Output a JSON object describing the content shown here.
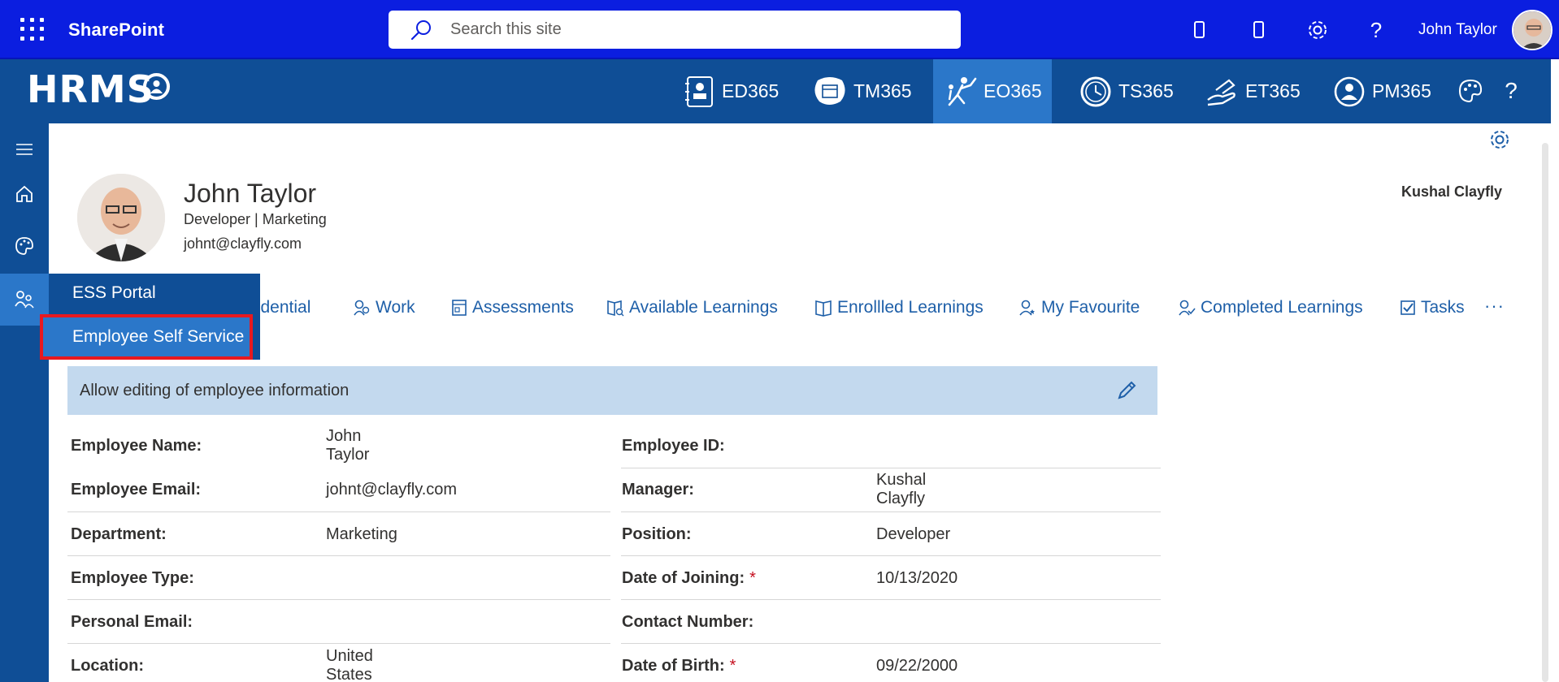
{
  "suitebar": {
    "brand": "SharePoint",
    "search_placeholder": "Search this site",
    "user_name": "John Taylor"
  },
  "hrms": {
    "logo": "HRMS",
    "apps": [
      {
        "label": "ED365",
        "icon": "employee-directory-icon"
      },
      {
        "label": "TM365",
        "icon": "calendar-bubble-icon"
      },
      {
        "label": "EO365",
        "icon": "onboarding-climber-icon"
      },
      {
        "label": "TS365",
        "icon": "clock-icon"
      },
      {
        "label": "ET365",
        "icon": "expense-hand-icon"
      },
      {
        "label": "PM365",
        "icon": "performance-person-icon"
      }
    ],
    "active_app": "EO365"
  },
  "rail": {
    "items": [
      "menu-icon",
      "home-icon",
      "palette-icon",
      "people-icon"
    ]
  },
  "flyout": {
    "header": "ESS Portal",
    "item": "Employee Self Service"
  },
  "profile": {
    "name": "John Taylor",
    "subtitle": "Developer | Marketing",
    "email": "johnt@clayfly.com",
    "manager": "Kushal Clayfly"
  },
  "tabs": {
    "partial": "fidential",
    "items": [
      "Work",
      "Assessments",
      "Available Learnings",
      "Enrollled Learnings",
      "My Favourite",
      "Completed Learnings",
      "Tasks"
    ],
    "more": "···"
  },
  "banner": {
    "text": "Allow editing of employee information"
  },
  "fields_left": [
    {
      "label": "Employee Name:",
      "value": "John Taylor"
    },
    {
      "label": "Employee Email:",
      "value": "johnt@clayfly.com"
    },
    {
      "label": "Department:",
      "value": "Marketing"
    },
    {
      "label": "Employee Type:",
      "value": ""
    },
    {
      "label": "Personal Email:",
      "value": ""
    },
    {
      "label": "Location:",
      "value": "United States"
    }
  ],
  "fields_right": [
    {
      "label": "Employee ID:",
      "value": "",
      "required": ""
    },
    {
      "label": "Manager:",
      "value": "Kushal Clayfly",
      "required": ""
    },
    {
      "label": "Position:",
      "value": "Developer",
      "required": ""
    },
    {
      "label": "Date of Joining:",
      "value": "10/13/2020",
      "required": "*"
    },
    {
      "label": "Contact Number:",
      "value": "",
      "required": ""
    },
    {
      "label": "Date of Birth:",
      "value": "09/22/2000",
      "required": "*"
    }
  ],
  "colors": {
    "suitebar": "#0b1ee0",
    "hrms_bar": "#0f4e96",
    "active_tab": "#2b77c9",
    "link": "#1e5fa8",
    "banner": "#c3d9ee",
    "highlight_border": "#e8191f"
  }
}
